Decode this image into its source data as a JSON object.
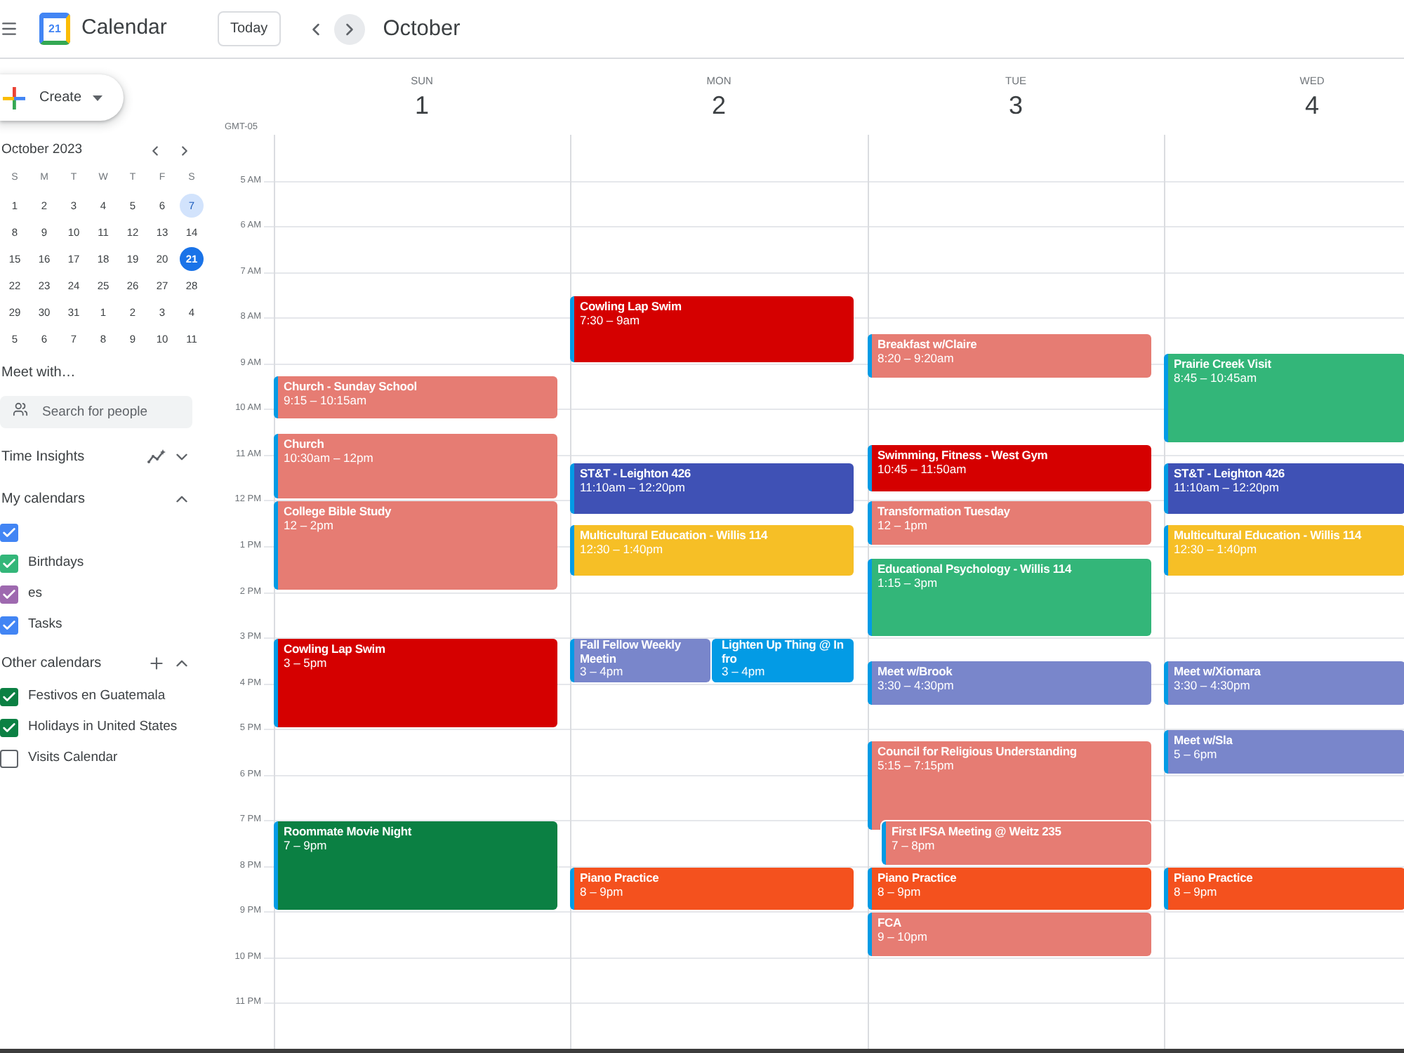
{
  "header": {
    "logo_text": "21",
    "app_title": "Calendar",
    "today_button": "Today",
    "nav_buttons": [
      {
        "kind": "prev",
        "hovered": false
      },
      {
        "kind": "next",
        "hovered": true
      }
    ],
    "period_title": "October"
  },
  "sidebar": {
    "create_button": "Create",
    "mini_calendar": {
      "title": "October 2023",
      "weekdays": [
        "S",
        "M",
        "T",
        "W",
        "T",
        "F",
        "S"
      ],
      "days": [
        {
          "label": "1",
          "selected": false,
          "today": false
        },
        {
          "label": "2",
          "selected": false,
          "today": false
        },
        {
          "label": "3",
          "selected": false,
          "today": false
        },
        {
          "label": "4",
          "selected": false,
          "today": false
        },
        {
          "label": "5",
          "selected": false,
          "today": false
        },
        {
          "label": "6",
          "selected": false,
          "today": false
        },
        {
          "label": "7",
          "selected": true,
          "today": false
        },
        {
          "label": "8",
          "selected": false,
          "today": false
        },
        {
          "label": "9",
          "selected": false,
          "today": false
        },
        {
          "label": "10",
          "selected": false,
          "today": false
        },
        {
          "label": "11",
          "selected": false,
          "today": false
        },
        {
          "label": "12",
          "selected": false,
          "today": false
        },
        {
          "label": "13",
          "selected": false,
          "today": false
        },
        {
          "label": "14",
          "selected": false,
          "today": false
        },
        {
          "label": "15",
          "selected": false,
          "today": false
        },
        {
          "label": "16",
          "selected": false,
          "today": false
        },
        {
          "label": "17",
          "selected": false,
          "today": false
        },
        {
          "label": "18",
          "selected": false,
          "today": false
        },
        {
          "label": "19",
          "selected": false,
          "today": false
        },
        {
          "label": "20",
          "selected": false,
          "today": false
        },
        {
          "label": "21",
          "selected": false,
          "today": true
        },
        {
          "label": "22",
          "selected": false,
          "today": false
        },
        {
          "label": "23",
          "selected": false,
          "today": false
        },
        {
          "label": "24",
          "selected": false,
          "today": false
        },
        {
          "label": "25",
          "selected": false,
          "today": false
        },
        {
          "label": "26",
          "selected": false,
          "today": false
        },
        {
          "label": "27",
          "selected": false,
          "today": false
        },
        {
          "label": "28",
          "selected": false,
          "today": false
        },
        {
          "label": "29",
          "selected": false,
          "today": false
        },
        {
          "label": "30",
          "selected": false,
          "today": false
        },
        {
          "label": "31",
          "selected": false,
          "today": false
        },
        {
          "label": "1",
          "selected": false,
          "today": false
        },
        {
          "label": "2",
          "selected": false,
          "today": false
        },
        {
          "label": "3",
          "selected": false,
          "today": false
        },
        {
          "label": "4",
          "selected": false,
          "today": false
        },
        {
          "label": "5",
          "selected": false,
          "today": false
        },
        {
          "label": "6",
          "selected": false,
          "today": false
        },
        {
          "label": "7",
          "selected": false,
          "today": false
        },
        {
          "label": "8",
          "selected": false,
          "today": false
        },
        {
          "label": "9",
          "selected": false,
          "today": false
        },
        {
          "label": "10",
          "selected": false,
          "today": false
        },
        {
          "label": "11",
          "selected": false,
          "today": false
        }
      ]
    },
    "meet_with": {
      "title": "Meet with…",
      "search_placeholder": "Search for people"
    },
    "time_insights": {
      "title": "Time Insights",
      "expanded": false
    },
    "my_calendars": {
      "title": "My calendars",
      "expanded": true,
      "items": [
        {
          "checked": true,
          "color": "#4285f4"
        },
        {
          "label": "Birthdays",
          "checked": true,
          "color": "#33b679"
        },
        {
          "label": "es",
          "checked": true,
          "color": "#9e69af"
        },
        {
          "label": "Tasks",
          "checked": true,
          "color": "#4285f4"
        }
      ]
    },
    "other_calendars": {
      "title": "Other calendars",
      "expanded": true,
      "items": [
        {
          "label": "Festivos en Guatemala",
          "checked": true,
          "color": "#0b8043"
        },
        {
          "label": "Holidays in United States",
          "checked": true,
          "color": "#0b8043"
        },
        {
          "label": "Visits Calendar",
          "checked": false
        }
      ]
    }
  },
  "week": {
    "timezone": "GMT-05",
    "time_labels": [
      "5 AM",
      "6 AM",
      "7 AM",
      "8 AM",
      "9 AM",
      "10 AM",
      "11 AM",
      "12 PM",
      "1 PM",
      "2 PM",
      "3 PM",
      "4 PM",
      "5 PM",
      "6 PM",
      "7 PM",
      "8 PM",
      "9 PM",
      "10 PM",
      "11 PM"
    ],
    "days": [
      {
        "name": "SUN",
        "number": "1",
        "events": [
          {
            "title": "Church - Sunday School",
            "time": "9:15 – 10:15am",
            "color": "#e67c73"
          },
          {
            "title": "Church",
            "time": "10:30am – 12pm",
            "color": "#e67c73"
          },
          {
            "title": "College Bible Study",
            "time": "12 – 2pm",
            "color": "#e67c73"
          },
          {
            "title": "Cowling Lap Swim",
            "time": "3 – 5pm",
            "color": "#d50000"
          },
          {
            "title": "Roommate Movie Night",
            "time": "7 – 9pm",
            "color": "#0b8043"
          }
        ]
      },
      {
        "name": "MON",
        "number": "2",
        "events": [
          {
            "title": "Cowling Lap Swim",
            "time": "7:30 – 9am",
            "color": "#d50000"
          },
          {
            "title": "ST&T - Leighton 426",
            "time": "11:10am – 12:20pm",
            "color": "#3f51b5"
          },
          {
            "title": "Multicultural Education - Willis 114",
            "time": "12:30 – 1:40pm",
            "color": "#f6bf26"
          },
          {
            "title": "Fall Fellow Weekly Meetin",
            "time": "3 – 4pm",
            "color": "#7986cb"
          },
          {
            "title": "Lighten Up Thing @ In fro",
            "time": "3 – 4pm",
            "color": "#039be5"
          },
          {
            "title": "Piano Practice",
            "time": "8 – 9pm",
            "color": "#f4511e"
          }
        ]
      },
      {
        "name": "TUE",
        "number": "3",
        "events": [
          {
            "title": "Breakfast w/Claire",
            "time": "8:20 – 9:20am",
            "color": "#e67c73"
          },
          {
            "title": "Swimming, Fitness - West Gym",
            "time": "10:45 – 11:50am",
            "color": "#d50000"
          },
          {
            "title": "Transformation Tuesday",
            "time": "12 – 1pm",
            "color": "#e67c73"
          },
          {
            "title": "Educational Psychology - Willis 114",
            "time": "1:15 – 3pm",
            "color": "#33b679"
          },
          {
            "title": "Meet w/Brook",
            "time": "3:30 – 4:30pm",
            "color": "#7986cb"
          },
          {
            "title": "Council for Religious Understanding",
            "time": "5:15 – 7:15pm",
            "color": "#e67c73"
          },
          {
            "title": "First IFSA Meeting @ Weitz 235",
            "time": "7 – 8pm",
            "color": "#e67c73"
          },
          {
            "title": "Piano Practice",
            "time": "8 – 9pm",
            "color": "#f4511e"
          },
          {
            "title": "FCA",
            "time": "9 – 10pm",
            "color": "#e67c73"
          }
        ]
      },
      {
        "name": "WED",
        "number": "4",
        "events": [
          {
            "title": "Prairie Creek Visit",
            "time": "8:45 – 10:45am",
            "color": "#33b679"
          },
          {
            "title": "ST&T - Leighton 426",
            "time": "11:10am – 12:20pm",
            "color": "#3f51b5"
          },
          {
            "title": "Multicultural Education - Willis 114",
            "time": "12:30 – 1:40pm",
            "color": "#f6bf26"
          },
          {
            "title": "Meet w/Xiomara",
            "time": "3:30 – 4:30pm",
            "color": "#7986cb"
          },
          {
            "title": "Meet w/Sla",
            "time": "5 – 6pm",
            "color": "#7986cb"
          },
          {
            "title": "Piano Practice",
            "time": "8 – 9pm",
            "color": "#f4511e"
          }
        ]
      }
    ]
  }
}
